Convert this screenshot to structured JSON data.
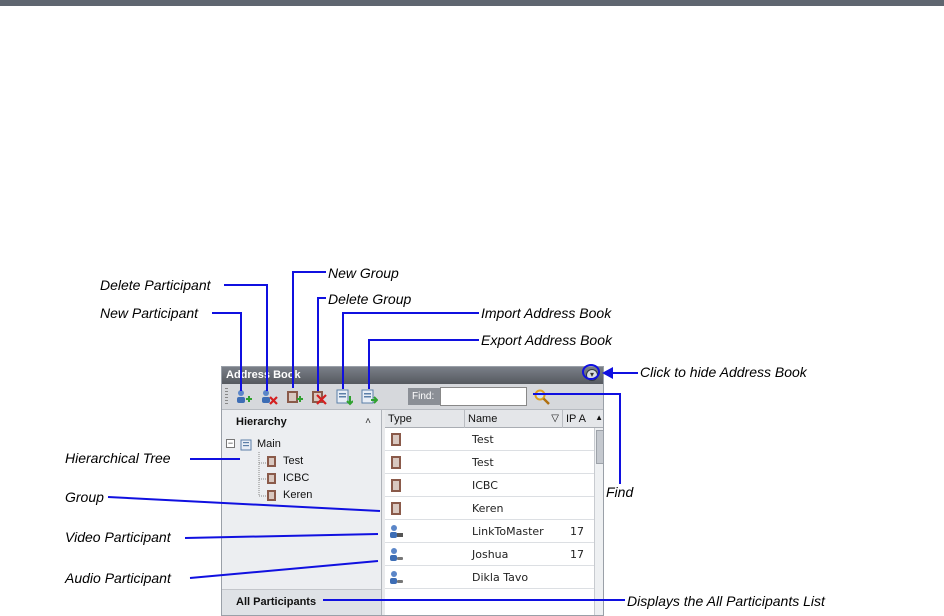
{
  "callouts": {
    "delete_participant": "Delete Participant",
    "new_group": "New Group",
    "delete_group": "Delete Group",
    "new_participant": "New Participant",
    "import_address_book": "Import Address Book",
    "export_address_book": "Export Address Book",
    "click_to_hide": "Click to hide Address Book",
    "hierarchical_tree": "Hierarchical Tree",
    "group": "Group",
    "video_participant": "Video Participant",
    "audio_participant": "Audio Participant",
    "find": "Find",
    "displays_all_participants": "Displays the All Participants List"
  },
  "address_book": {
    "title": "Address Book",
    "find_label": "Find:",
    "find_value": "",
    "hierarchy_title": "Hierarchy",
    "tree": {
      "root": "Main",
      "children": [
        "Test",
        "ICBC",
        "Keren"
      ]
    },
    "all_participants": "All Participants",
    "columns": {
      "type": "Type",
      "name": "Name",
      "ip": "IP A"
    },
    "rows": [
      {
        "type": "group",
        "name": "Test",
        "ip": ""
      },
      {
        "type": "group",
        "name": "Test",
        "ip": ""
      },
      {
        "type": "group",
        "name": "ICBC",
        "ip": ""
      },
      {
        "type": "group",
        "name": "Keren",
        "ip": ""
      },
      {
        "type": "video-participant",
        "name": "LinkToMaster",
        "ip": "17"
      },
      {
        "type": "audio-participant",
        "name": "Joshua",
        "ip": "17"
      },
      {
        "type": "audio-participant",
        "name": "Dikla Tavo",
        "ip": ""
      }
    ]
  },
  "colors": {
    "callout_line": "#1010e0",
    "topbar": "#5f6670"
  }
}
